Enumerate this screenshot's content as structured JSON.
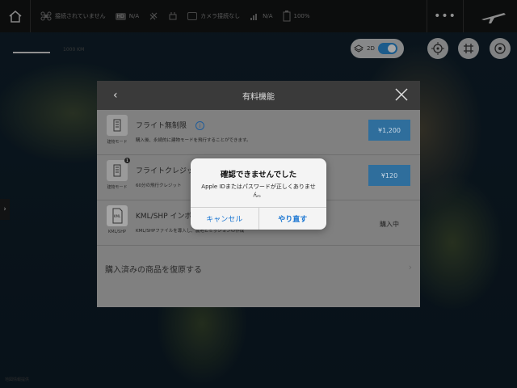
{
  "topbar": {
    "status_connection": "接続されていません",
    "signal_tag": "HD",
    "signal_value": "N/A",
    "camera_status": "カメラ接続なし",
    "rc_value": "N/A",
    "battery": "100%",
    "more": "•••",
    "icons": [
      "home-icon",
      "drone-icon",
      "signal-icon",
      "satellite-icon",
      "remote-icon",
      "camera-icon",
      "rc-signal-icon",
      "battery-icon",
      "more-icon",
      "takeoff-icon"
    ]
  },
  "map": {
    "scale_text": "1000 KM",
    "toggle_label": "2D",
    "footer": "地図情報提供"
  },
  "panel": {
    "title": "有料機能",
    "items": [
      {
        "title": "フライト無制限",
        "sub": "建物モード",
        "desc": "購入後、永続的に建物モードを飛行することができます。",
        "price": "¥1,200",
        "badge": ""
      },
      {
        "title": "フライトクレジット",
        "sub": "建物モード",
        "desc": "60分の飛行クレジット",
        "price": "¥120",
        "badge": "1"
      },
      {
        "title": "KML/SHP インポート",
        "sub": "KML/SHP",
        "desc": "KML/SHPファイルを導入し、農地とミッションの作成",
        "status": "購入中",
        "icon_text": "KML"
      }
    ],
    "restore_label": "購入済みの商品を復原する"
  },
  "alert": {
    "title": "確認できませんでした",
    "message": "Apple IDまたはパスワードが正しくありません。",
    "cancel": "キャンセル",
    "retry": "やり直す"
  },
  "colors": {
    "accent": "#1a76d2",
    "price_bg": "#2f6e9c",
    "toggle_on": "#2b8cd6"
  }
}
